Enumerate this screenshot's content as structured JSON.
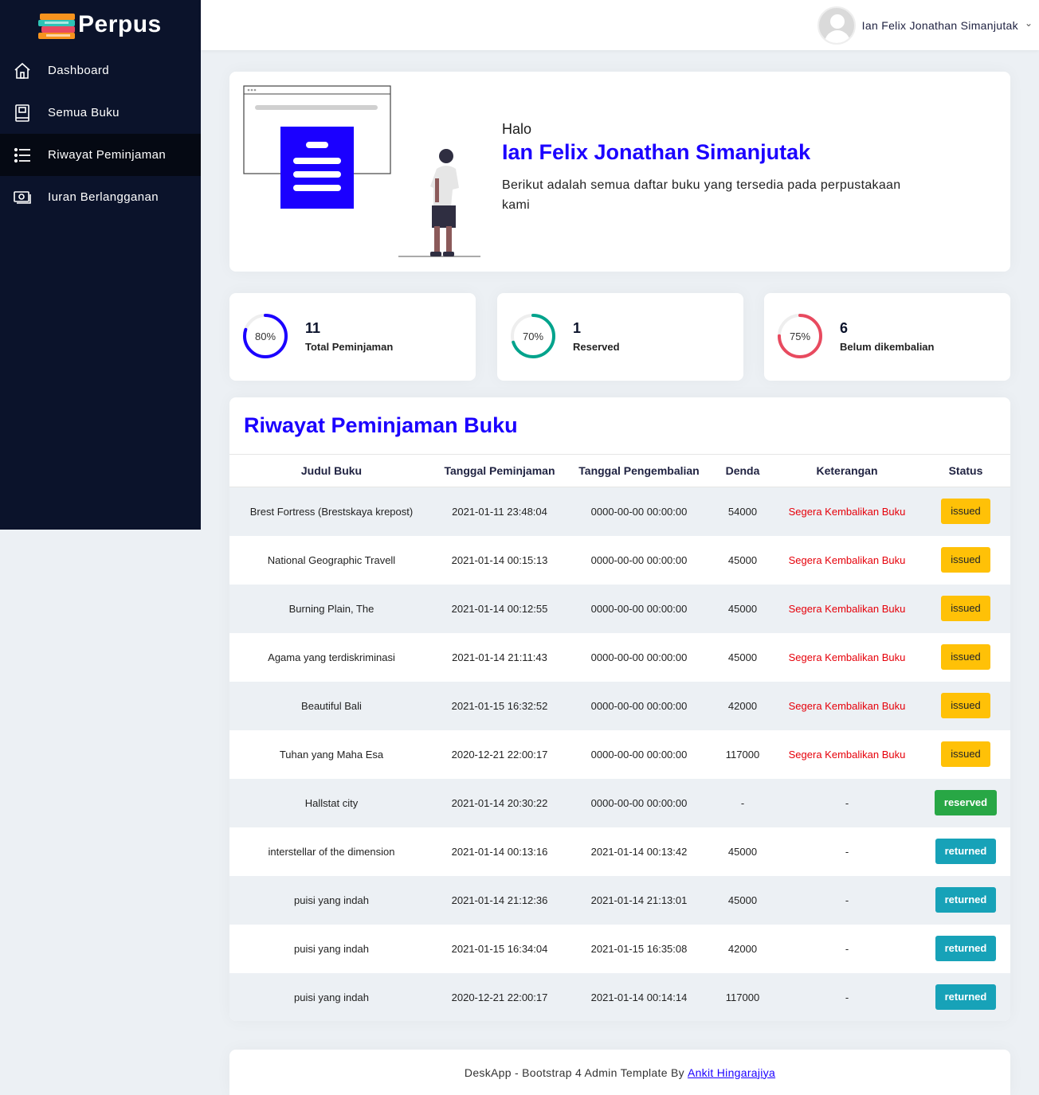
{
  "app": {
    "brand": "Perpus"
  },
  "sidebar": {
    "items": [
      {
        "label": "Dashboard",
        "icon": "home-icon",
        "active": false
      },
      {
        "label": "Semua Buku",
        "icon": "book-icon",
        "active": false
      },
      {
        "label": "Riwayat Peminjaman",
        "icon": "list-icon",
        "active": true
      },
      {
        "label": "Iuran Berlangganan",
        "icon": "money-icon",
        "active": false
      }
    ]
  },
  "header": {
    "user_name": "Ian Felix Jonathan Simanjutak"
  },
  "welcome": {
    "greeting": "Halo",
    "name": "Ian Felix Jonathan Simanjutak",
    "description": "Berikut adalah semua daftar buku yang tersedia pada perpustakaan kami"
  },
  "stats": [
    {
      "percent_label": "80%",
      "percent": 0.8,
      "value": "11",
      "label": "Total Peminjaman",
      "color": "#1b00ff"
    },
    {
      "percent_label": "70%",
      "percent": 0.7,
      "value": "1",
      "label": "Reserved",
      "color": "#00a38c"
    },
    {
      "percent_label": "75%",
      "percent": 0.75,
      "value": "6",
      "label": "Belum dikembalian",
      "color": "#e84a5f"
    }
  ],
  "table": {
    "title": "Riwayat Peminjaman Buku",
    "headers": [
      "Judul Buku",
      "Tanggal Peminjaman",
      "Tanggal Pengembalian",
      "Denda",
      "Keterangan",
      "Status"
    ],
    "rows": [
      [
        "Brest Fortress (Brestskaya krepost)",
        "2021-01-11 23:48:04",
        "0000-00-00 00:00:00",
        "54000",
        "Segera Kembalikan Buku",
        "issued"
      ],
      [
        "National Geographic Travell",
        "2021-01-14 00:15:13",
        "0000-00-00 00:00:00",
        "45000",
        "Segera Kembalikan Buku",
        "issued"
      ],
      [
        "Burning Plain, The",
        "2021-01-14 00:12:55",
        "0000-00-00 00:00:00",
        "45000",
        "Segera Kembalikan Buku",
        "issued"
      ],
      [
        "Agama yang terdiskriminasi",
        "2021-01-14 21:11:43",
        "0000-00-00 00:00:00",
        "45000",
        "Segera Kembalikan Buku",
        "issued"
      ],
      [
        "Beautiful Bali",
        "2021-01-15 16:32:52",
        "0000-00-00 00:00:00",
        "42000",
        "Segera Kembalikan Buku",
        "issued"
      ],
      [
        "Tuhan yang Maha Esa",
        "2020-12-21 22:00:17",
        "0000-00-00 00:00:00",
        "117000",
        "Segera Kembalikan Buku",
        "issued"
      ],
      [
        "Hallstat city",
        "2021-01-14 20:30:22",
        "0000-00-00 00:00:00",
        "-",
        "-",
        "reserved"
      ],
      [
        "interstellar of the dimension",
        "2021-01-14 00:13:16",
        "2021-01-14 00:13:42",
        "45000",
        "-",
        "returned"
      ],
      [
        "puisi yang indah",
        "2021-01-14 21:12:36",
        "2021-01-14 21:13:01",
        "45000",
        "-",
        "returned"
      ],
      [
        "puisi yang indah",
        "2021-01-15 16:34:04",
        "2021-01-15 16:35:08",
        "42000",
        "-",
        "returned"
      ],
      [
        "puisi yang indah",
        "2020-12-21 22:00:17",
        "2021-01-14 00:14:14",
        "117000",
        "-",
        "returned"
      ]
    ]
  },
  "footer": {
    "text": "DeskApp - Bootstrap 4 Admin Template By",
    "link_text": "Ankit Hingarajiya"
  }
}
